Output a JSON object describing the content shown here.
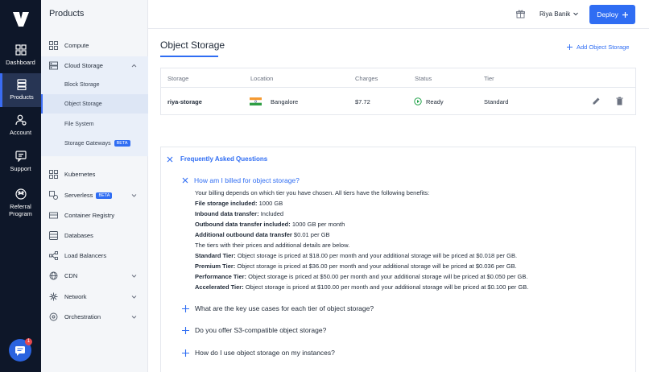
{
  "rail": {
    "items": [
      {
        "label": "Dashboard",
        "icon": "dashboard-icon"
      },
      {
        "label": "Products",
        "icon": "products-icon"
      },
      {
        "label": "Account",
        "icon": "account-icon"
      },
      {
        "label": "Support",
        "icon": "support-icon"
      },
      {
        "label": "Referral",
        "label2": "Program",
        "icon": "referral-icon"
      }
    ],
    "chat_badge": "1"
  },
  "subnav": {
    "title": "Products",
    "items": [
      {
        "label": "Compute",
        "icon": "compute-icon"
      },
      {
        "label": "Cloud Storage",
        "icon": "cloud-storage-icon"
      },
      {
        "label": "Kubernetes",
        "icon": "kubernetes-icon"
      },
      {
        "label": "Serverless",
        "icon": "serverless-icon",
        "badge": "BETA"
      },
      {
        "label": "Container Registry",
        "icon": "container-registry-icon"
      },
      {
        "label": "Databases",
        "icon": "databases-icon"
      },
      {
        "label": "Load Balancers",
        "icon": "load-balancers-icon"
      },
      {
        "label": "CDN",
        "icon": "cdn-icon"
      },
      {
        "label": "Network",
        "icon": "network-icon"
      },
      {
        "label": "Orchestration",
        "icon": "orchestration-icon"
      }
    ],
    "storage_sub": [
      {
        "label": "Block Storage"
      },
      {
        "label": "Object Storage"
      },
      {
        "label": "File System"
      },
      {
        "label": "Storage Gateways",
        "badge": "BETA"
      }
    ]
  },
  "header": {
    "user_name": "Riya Banik",
    "deploy_label": "Deploy"
  },
  "main": {
    "title": "Object Storage",
    "add_label": "Add Object Storage",
    "table": {
      "headers": [
        "Storage",
        "Location",
        "Charges",
        "Status",
        "Tier"
      ],
      "row": {
        "storage": "riya-storage",
        "location": "Bangalore",
        "charges": "$7.72",
        "status": "Ready",
        "tier": "Standard"
      }
    },
    "faq": {
      "title": "Frequently Asked Questions",
      "open_question": "How am I billed for object storage?",
      "answer_intro": "Your billing depends on which tier you have chosen. All tiers have the following benefits:",
      "benefits": [
        {
          "label": "File storage included:",
          "value": "1000 GB"
        },
        {
          "label": "Inbound data transfer:",
          "value": "Included"
        },
        {
          "label": "Outbound data transfer included:",
          "value": "1000 GB per month"
        },
        {
          "label": "Additional outbound data transfer",
          "value": "$0.01 per GB"
        }
      ],
      "tiers_intro": "The tiers with their prices and additional details are below.",
      "tiers": [
        {
          "label": "Standard Tier:",
          "value": "Object storage is priced at $18.00 per month and your additional storage will be priced at $0.018 per GB."
        },
        {
          "label": "Premium Tier:",
          "value": "Object storage is priced at $36.00 per month and your additional storage will be priced at $0.036 per GB."
        },
        {
          "label": "Performance Tier:",
          "value": "Object storage is priced at $50.00 per month and your additional storage will be priced at $0.050 per GB."
        },
        {
          "label": "Accelerated Tier:",
          "value": "Object storage is priced at $100.00 per month and your additional storage will be priced at $0.100 per GB."
        }
      ],
      "questions": [
        "What are the key use cases for each tier of object storage?",
        "Do you offer S3-compatible object storage?",
        "How do I use object storage on my instances?"
      ]
    }
  },
  "colors": {
    "accent": "#2f6df3",
    "rail_bg": "#0e1729",
    "ready_green": "#22a34a"
  }
}
